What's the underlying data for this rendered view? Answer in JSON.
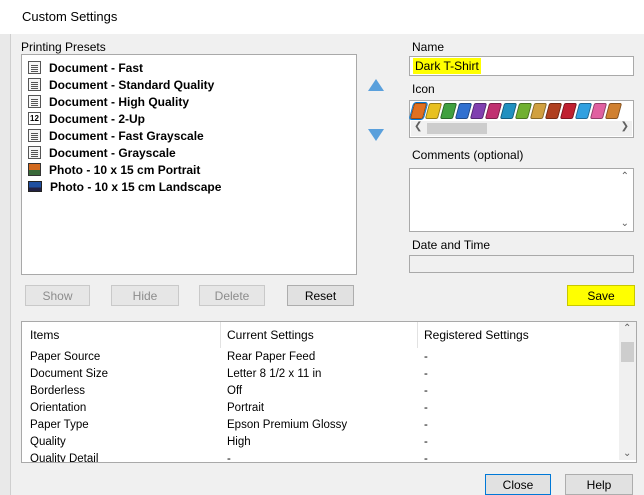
{
  "window": {
    "title": "Custom Settings"
  },
  "presets": {
    "label": "Printing Presets",
    "items": [
      {
        "label": "Document - Fast",
        "icon": "document-icon"
      },
      {
        "label": "Document - Standard Quality",
        "icon": "document-icon"
      },
      {
        "label": "Document - High Quality",
        "icon": "document-icon"
      },
      {
        "label": "Document - 2-Up",
        "icon": "two-up-icon"
      },
      {
        "label": "Document - Fast Grayscale",
        "icon": "document-icon"
      },
      {
        "label": "Document - Grayscale",
        "icon": "document-icon"
      },
      {
        "label": "Photo - 10 x 15 cm Portrait",
        "icon": "photo-portrait-icon"
      },
      {
        "label": "Photo - 10 x 15 cm Landscape",
        "icon": "photo-landscape-icon"
      }
    ],
    "buttons": {
      "show": "Show",
      "hide": "Hide",
      "delete": "Delete",
      "reset": "Reset"
    }
  },
  "form": {
    "name_label": "Name",
    "name_value": "Dark T-Shirt",
    "icon_label": "Icon",
    "icon_colors": [
      "#e07020",
      "#e8c020",
      "#40a040",
      "#3070d0",
      "#8040b0",
      "#c03070",
      "#2090c0",
      "#70b030",
      "#d0a040",
      "#b04020",
      "#c02030",
      "#30a0e0",
      "#e060a0",
      "#d08030"
    ],
    "comments_label": "Comments (optional)",
    "date_label": "Date and Time",
    "save_label": "Save"
  },
  "table": {
    "columns": [
      "Items",
      "Current Settings",
      "Registered Settings"
    ],
    "rows": [
      [
        "Paper Source",
        "Rear Paper Feed",
        "-"
      ],
      [
        "Document Size",
        "Letter 8 1/2 x 11 in",
        "-"
      ],
      [
        "Borderless",
        "Off",
        "-"
      ],
      [
        "Orientation",
        "Portrait",
        "-"
      ],
      [
        "Paper Type",
        "Epson Premium Glossy",
        "-"
      ],
      [
        "Quality",
        "High",
        "-"
      ],
      [
        "Quality Detail",
        "-",
        "-"
      ]
    ]
  },
  "footer": {
    "close_label": "Close",
    "help_label": "Help"
  },
  "colors": {
    "highlight": "#ffff00",
    "arrow_blue": "#5aa0dc"
  }
}
